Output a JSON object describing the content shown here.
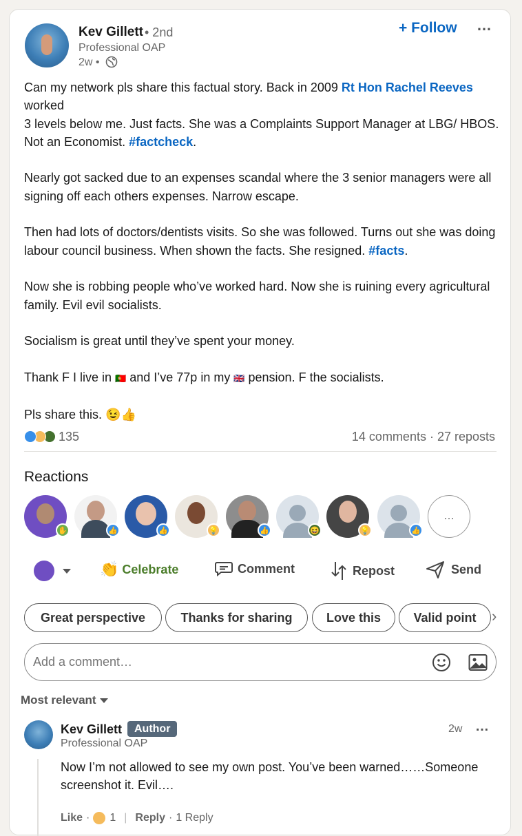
{
  "post": {
    "author": {
      "name": "Kev Gillett",
      "degree": "• 2nd",
      "headline": "Professional OAP",
      "time": "2w •"
    },
    "follow_label": "+ Follow",
    "more_icon": "…",
    "text": {
      "p1_a": "Can my network pls share this factual story. Back in 2009 ",
      "p1_mention": "Rt Hon Rachel Reeves",
      "p1_b": " worked",
      "p1_c": "3 levels below me. Just facts. She was a Complaints Support Manager at LBG/ HBOS. Not an Economist. ",
      "p1_tag": "#factcheck",
      "p1_end": ".",
      "p2": "Nearly got sacked due to an expenses scandal where the 3 senior managers were all signing off each others expenses. Narrow escape.",
      "p3_a": "Then had lots of doctors/dentists visits. So she was followed. Turns out she was doing labour council business. When shown the facts. She resigned. ",
      "p3_tag": "#facts",
      "p3_end": ".",
      "p4": "Now she is robbing people who’ve worked hard. Now she is ruining every agricultural family. Evil evil socialists.",
      "p5": "Socialism is great until they’ve spent your money.",
      "p6_a": "Thank F I live in ",
      "p6_flag1": "🇵🇹",
      "p6_b": " and I’ve 77p in my ",
      "p6_flag2": "🇬🇧",
      "p6_c": " pension. F the socialists.",
      "p7": "Pls share this. 😉👍"
    },
    "reaction_count": "135",
    "comments_reposts": "14 comments · 27 reposts"
  },
  "reactions": {
    "title": "Reactions",
    "more_label": "…",
    "people": [
      {
        "badge": "clap",
        "color": "#6f4ec2"
      },
      {
        "badge": "like",
        "color": "#3d4c5c"
      },
      {
        "badge": "like",
        "color": "#2a5aa7"
      },
      {
        "badge": "insight",
        "color": "#c9b28f"
      },
      {
        "badge": "like",
        "color": "#3a3a3a"
      },
      {
        "badge": "funny",
        "color": "#c7d0da"
      },
      {
        "badge": "insight",
        "color": "#454545"
      },
      {
        "badge": "like",
        "color": "#c7d0da"
      }
    ]
  },
  "actions": {
    "celebrate": "Celebrate",
    "comment": "Comment",
    "repost": "Repost",
    "send": "Send",
    "celebrate_color": "#4b7d2a"
  },
  "suggestions": [
    "Great perspective",
    "Thanks for sharing",
    "Love this",
    "Valid point"
  ],
  "comment_box": {
    "placeholder": "Add a comment…"
  },
  "sort_label": "Most relevant",
  "comments": [
    {
      "name": "Kev Gillett",
      "badge": "Author",
      "headline": "Professional OAP",
      "time": "2w",
      "text": "Now I’m not allowed to see my own post. You’ve been warned……Someone screenshot it. Evil….",
      "like_label": "Like",
      "reaction_count": "1",
      "reply_label": "Reply",
      "replies": "1 Reply"
    }
  ],
  "colors": {
    "link": "#0a66c2",
    "like": "#378fe9",
    "insight": "#f5bb5c",
    "celebrate": "#6dae4f"
  }
}
